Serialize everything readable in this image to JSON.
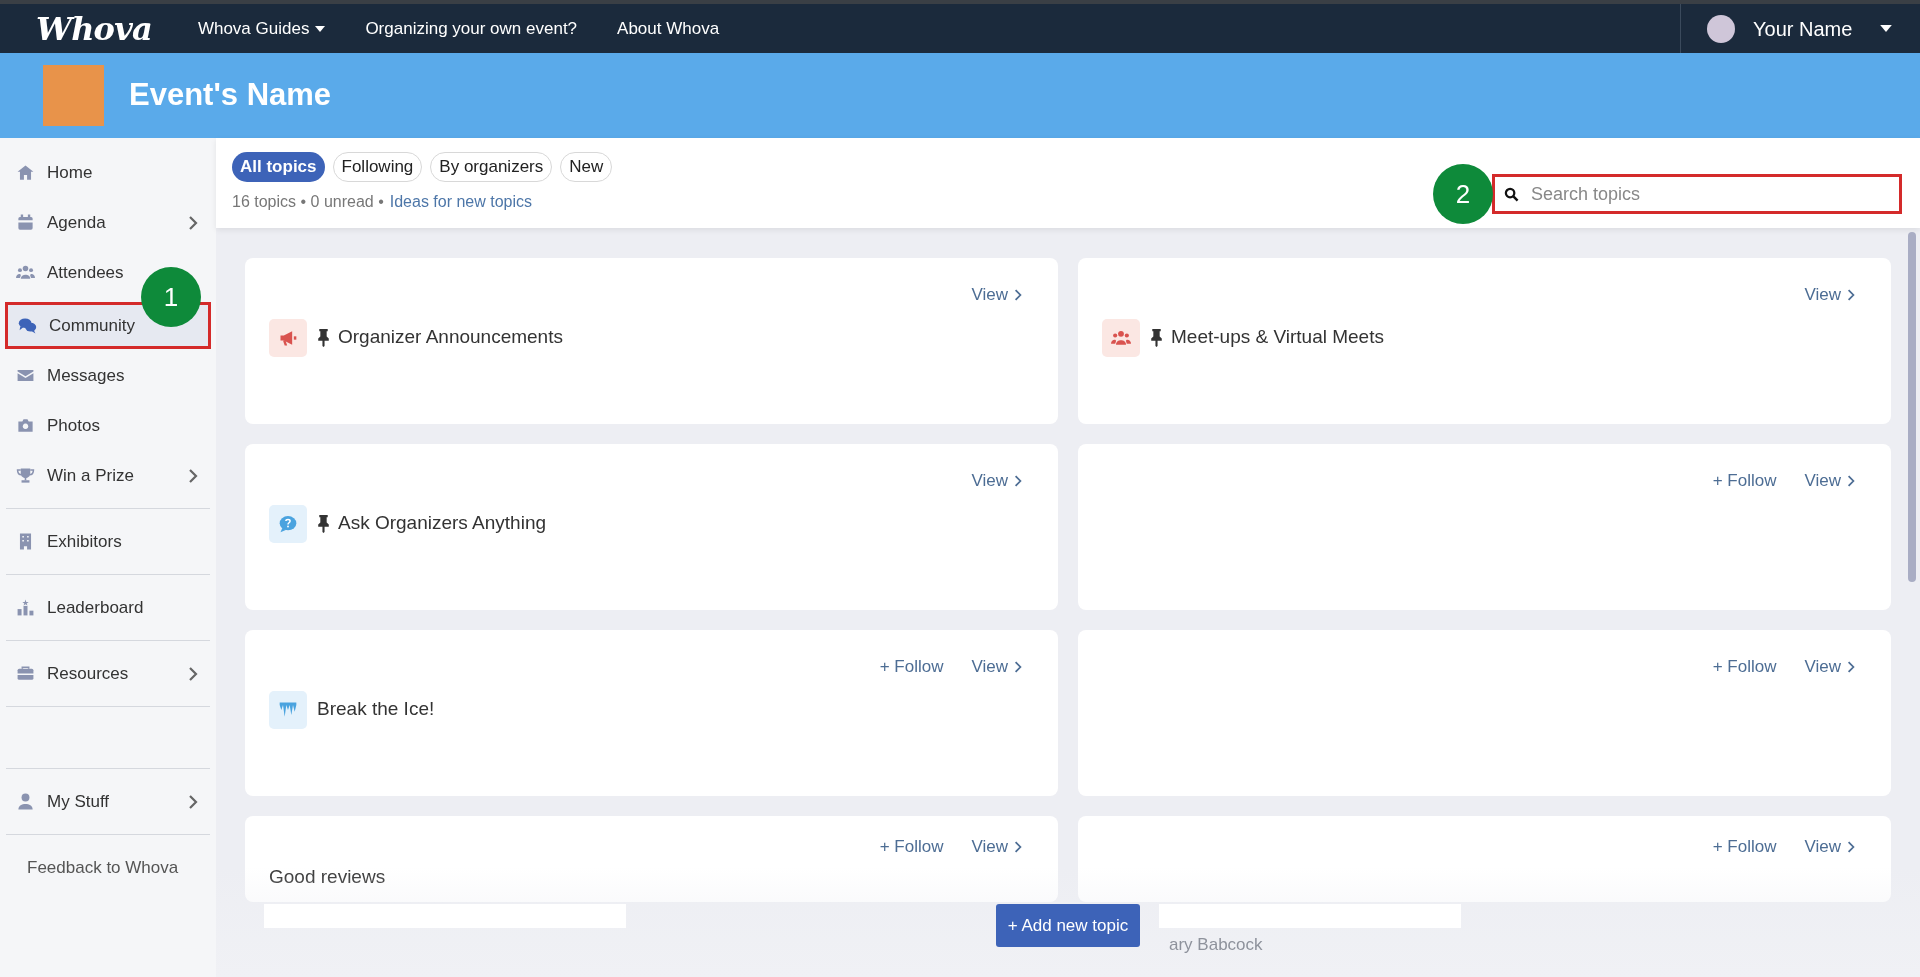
{
  "topbar": {
    "logo": "Whova",
    "nav": [
      {
        "label": "Whova Guides",
        "dropdown": true
      },
      {
        "label": "Organizing your own event?",
        "dropdown": false
      },
      {
        "label": "About Whova",
        "dropdown": false
      }
    ],
    "user": "Your Name"
  },
  "banner": {
    "event_name": "Event's Name"
  },
  "sidebar": {
    "sections": [
      {
        "items": [
          {
            "label": "Home",
            "kind": "home",
            "chevron": false,
            "selected": false
          },
          {
            "label": "Agenda",
            "kind": "calendar",
            "chevron": true,
            "selected": false
          },
          {
            "label": "Attendees",
            "kind": "people",
            "chevron": false,
            "selected": false
          },
          {
            "label": "Community",
            "kind": "chat",
            "chevron": false,
            "selected": true,
            "annotation": "1"
          },
          {
            "label": "Messages",
            "kind": "mail",
            "chevron": false,
            "selected": false
          },
          {
            "label": "Photos",
            "kind": "camera",
            "chevron": false,
            "selected": false
          },
          {
            "label": "Win a Prize",
            "kind": "trophy",
            "chevron": true,
            "selected": false
          }
        ]
      },
      {
        "items": [
          {
            "label": "Exhibitors",
            "kind": "building",
            "chevron": false,
            "selected": false
          }
        ]
      },
      {
        "items": [
          {
            "label": "Leaderboard",
            "kind": "podium",
            "chevron": false,
            "selected": false
          }
        ]
      },
      {
        "items": [
          {
            "label": "Resources",
            "kind": "briefcase",
            "chevron": true,
            "selected": false
          }
        ]
      },
      {
        "items": [
          {
            "label": "My Stuff",
            "kind": "user",
            "chevron": true,
            "selected": false
          }
        ]
      }
    ],
    "footer": "Feedback to Whova"
  },
  "filters": [
    {
      "label": "All topics",
      "selected": true
    },
    {
      "label": "Following",
      "selected": false
    },
    {
      "label": "By organizers",
      "selected": false
    },
    {
      "label": "New",
      "selected": false
    }
  ],
  "summary": {
    "counts": "16 topics • 0 unread •",
    "link": "Ideas for new topics"
  },
  "search": {
    "placeholder": "Search topics",
    "annotation": "2"
  },
  "topics": [
    {
      "title": "Organizer Announcements",
      "kind": "megaphone",
      "pinned": true,
      "view": "View"
    },
    {
      "title": "Meet-ups & Virtual Meets",
      "kind": "people",
      "pinned": true,
      "view": "View"
    },
    {
      "title": "Ask Organizers Anything",
      "kind": "question",
      "pinned": true,
      "view": "View"
    },
    {
      "kind": "blank",
      "pinned": false,
      "follow": "+ Follow",
      "view": "View"
    },
    {
      "title": "Break the Ice!",
      "kind": "icicle",
      "pinned": false,
      "follow": "+ Follow",
      "view": "View"
    },
    {
      "kind": "blank",
      "pinned": false,
      "follow": "+ Follow",
      "view": "View"
    },
    {
      "title": "Good reviews",
      "kind": "loading",
      "pinned": false,
      "follow": "+ Follow",
      "view": "View"
    },
    {
      "kind": "loading",
      "pinned": false,
      "follow": "+ Follow",
      "view": "View",
      "faded_text": "ary Babcock"
    }
  ],
  "add_button": "+ Add new topic"
}
